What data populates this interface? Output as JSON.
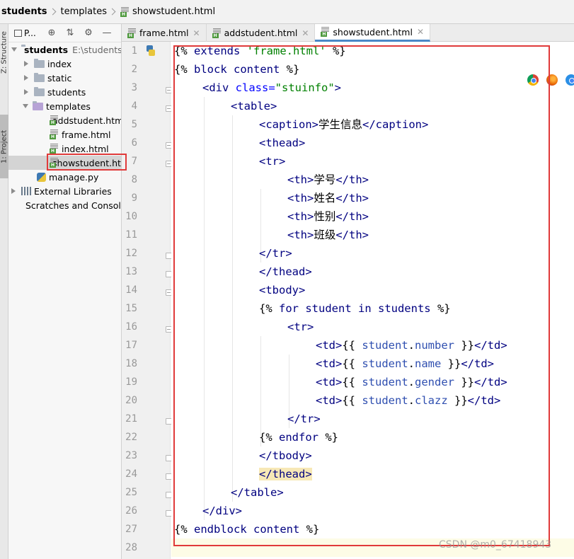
{
  "breadcrumb": {
    "project": "students",
    "folder": "templates",
    "file": "showstudent.html"
  },
  "toolstrip": {
    "structure_label": "Z: Structure",
    "project_label": "1: Project"
  },
  "project_panel": {
    "view_label": "P...",
    "root": {
      "name": "students",
      "path": "E:\\students"
    },
    "items": [
      {
        "name": "index"
      },
      {
        "name": "static"
      },
      {
        "name": "students"
      },
      {
        "name": "templates"
      },
      {
        "name": "addstudent.html"
      },
      {
        "name": "frame.html"
      },
      {
        "name": "index.html"
      },
      {
        "name": "showstudent.html"
      },
      {
        "name": "manage.py"
      },
      {
        "name": "External Libraries"
      },
      {
        "name": "Scratches and Consoles"
      }
    ]
  },
  "tabs": [
    {
      "label": "frame.html",
      "active": false
    },
    {
      "label": "addstudent.html",
      "active": false
    },
    {
      "label": "showstudent.html",
      "active": true
    }
  ],
  "line_numbers": [
    "1",
    "2",
    "3",
    "4",
    "5",
    "6",
    "7",
    "8",
    "9",
    "10",
    "11",
    "12",
    "13",
    "14",
    "15",
    "16",
    "17",
    "18",
    "19",
    "20",
    "21",
    "22",
    "23",
    "24",
    "25",
    "26",
    "27",
    "28"
  ],
  "code": {
    "l1": {
      "a": "{% ",
      "b": "extends ",
      "c": "'frame.html'",
      "d": " %}"
    },
    "l2": {
      "a": "{% ",
      "b": "block ",
      "c": "content",
      "d": " %}"
    },
    "l3": {
      "a": "<div ",
      "b": "class=",
      "c": "\"stuinfo\"",
      "d": ">"
    },
    "l4": "<table>",
    "l5": {
      "a": "<caption>",
      "b": "学生信息",
      "c": "</caption>"
    },
    "l6": "<thead>",
    "l7": "<tr>",
    "l8": {
      "a": "<th>",
      "b": "学号",
      "c": "</th>"
    },
    "l9": {
      "a": "<th>",
      "b": "姓名",
      "c": "</th>"
    },
    "l10": {
      "a": "<th>",
      "b": "性别",
      "c": "</th>"
    },
    "l11": {
      "a": "<th>",
      "b": "班级",
      "c": "</th>"
    },
    "l12": "</tr>",
    "l13": "</thead>",
    "l14": "<tbody>",
    "l15": {
      "a": "{% ",
      "b": "for ",
      "c": "student ",
      "d": "in ",
      "e": "students",
      "f": " %}"
    },
    "l16": "<tr>",
    "l17": {
      "a": "<td>",
      "b": "{{ ",
      "c": "student",
      "d": ".",
      "e": "number",
      "f": " }}",
      "g": "</td>"
    },
    "l18": {
      "a": "<td>",
      "b": "{{ ",
      "c": "student",
      "d": ".",
      "e": "name",
      "f": " }}",
      "g": "</td>"
    },
    "l19": {
      "a": "<td>",
      "b": "{{ ",
      "c": "student",
      "d": ".",
      "e": "gender",
      "f": " }}",
      "g": "</td>"
    },
    "l20": {
      "a": "<td>",
      "b": "{{ ",
      "c": "student",
      "d": ".",
      "e": "clazz",
      "f": " }}",
      "g": "</td>"
    },
    "l21": "</tr>",
    "l22": {
      "a": "{% ",
      "b": "endfor",
      "c": " %}"
    },
    "l23": "</tbody>",
    "l24": "</thead>",
    "l25": "</table>",
    "l26": "</div>",
    "l27": {
      "a": "{% ",
      "b": "endblock ",
      "c": "content",
      "d": " %}"
    }
  },
  "browser_icons": [
    "chrome-icon",
    "firefox-icon",
    "safari-icon"
  ],
  "watermark": "CSDN @m0_67418943",
  "colors": {
    "highlight_box": "#e03a3a",
    "active_tab_underline": "#4a88c7",
    "tag": "#000080",
    "string": "#008000",
    "attribute": "#0000ff"
  }
}
